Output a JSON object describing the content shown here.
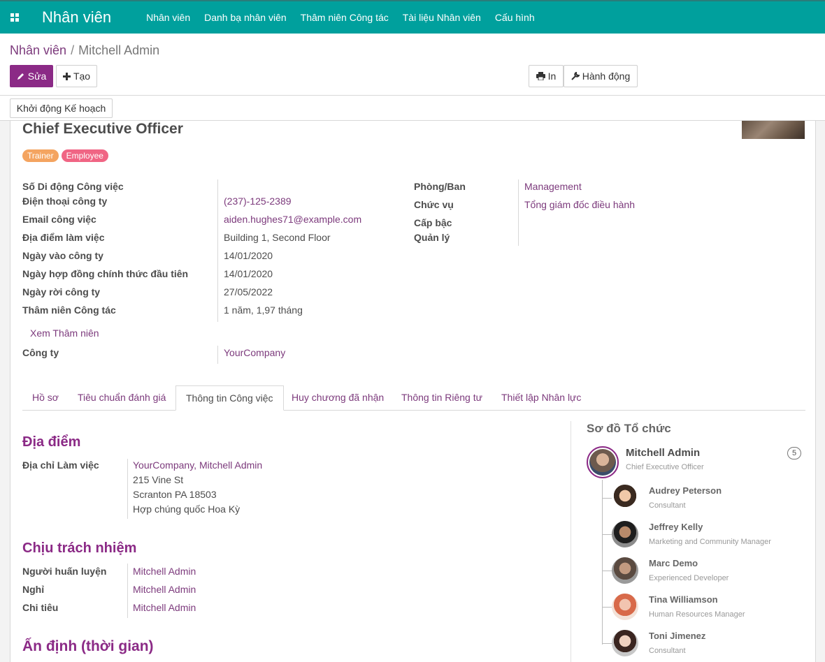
{
  "navbar": {
    "brand": "Nhân viên",
    "menu": [
      "Nhân viên",
      "Danh bạ nhân viên",
      "Thâm niên Công tác",
      "Tài liệu Nhân viên",
      "Cấu hình"
    ]
  },
  "breadcrumb": {
    "parent": "Nhân viên",
    "separator": "/",
    "current": "Mitchell Admin"
  },
  "toolbar": {
    "edit": "Sửa",
    "create": "Tạo",
    "print": "In",
    "action": "Hành động"
  },
  "statusbar": {
    "launch_plan": "Khởi động Kế hoạch"
  },
  "employee": {
    "job_title": "Chief Executive Officer",
    "tags": [
      {
        "label": "Trainer",
        "color": "#f4a460"
      },
      {
        "label": "Employee",
        "color": "#f06584"
      }
    ]
  },
  "left_fields": {
    "mobile_label": "Số Di động Công việc",
    "mobile_value": "",
    "phone_label": "Điện thoại công ty",
    "phone_value": "(237)-125-2389",
    "email_label": "Email công việc",
    "email_value": "aiden.hughes71@example.com",
    "location_label": "Địa điểm làm việc",
    "location_value": "Building 1, Second Floor",
    "join_label": "Ngày vào công ty",
    "join_value": "14/01/2020",
    "contract_label": "Ngày hợp đồng chính thức đầu tiên",
    "contract_value": "14/01/2020",
    "leave_label": "Ngày rời công ty",
    "leave_value": "27/05/2022",
    "seniority_label": "Thâm niên Công tác",
    "seniority_value": "1 năm, 1,97 tháng",
    "view_seniority": "Xem Thâm niên",
    "company_label": "Công ty",
    "company_value": "YourCompany"
  },
  "right_fields": {
    "department_label": "Phòng/Ban",
    "department_value": "Management",
    "position_label": "Chức vụ",
    "position_value": "Tổng giám đốc điều hành",
    "level_label": "Cấp bậc",
    "manager_label": "Quản lý"
  },
  "tabs": [
    "Hồ sơ",
    "Tiêu chuẩn đánh giá",
    "Thông tin Công việc",
    "Huy chương đã nhận",
    "Thông tin Riêng tư",
    "Thiết lập Nhân lực"
  ],
  "work_info": {
    "location_title": "Địa điểm",
    "work_address_label": "Địa chỉ Làm việc",
    "work_address_name": "YourCompany, Mitchell Admin",
    "address_line1": "215 Vine St",
    "address_line2": "Scranton PA 18503",
    "address_line3": "Hợp chúng quốc Hoa Kỳ",
    "responsible_title": "Chịu trách nhiệm",
    "trainer_label": "Người huấn luyện",
    "trainer_value": "Mitchell Admin",
    "leave_label": "Nghỉ",
    "leave_value": "Mitchell Admin",
    "expense_label": "Chi tiêu",
    "expense_value": "Mitchell Admin",
    "schedule_title": "Ấn định (thời gian)"
  },
  "org_chart": {
    "title": "Sơ đồ Tổ chức",
    "main": {
      "name": "Mitchell Admin",
      "role": "Chief Executive Officer",
      "count": "5"
    },
    "subordinates": [
      {
        "name": "Audrey Peterson",
        "role": "Consultant"
      },
      {
        "name": "Jeffrey Kelly",
        "role": "Marketing and Community Manager"
      },
      {
        "name": "Marc Demo",
        "role": "Experienced Developer"
      },
      {
        "name": "Tina Williamson",
        "role": "Human Resources Manager"
      },
      {
        "name": "Toni Jimenez",
        "role": "Consultant"
      }
    ]
  }
}
